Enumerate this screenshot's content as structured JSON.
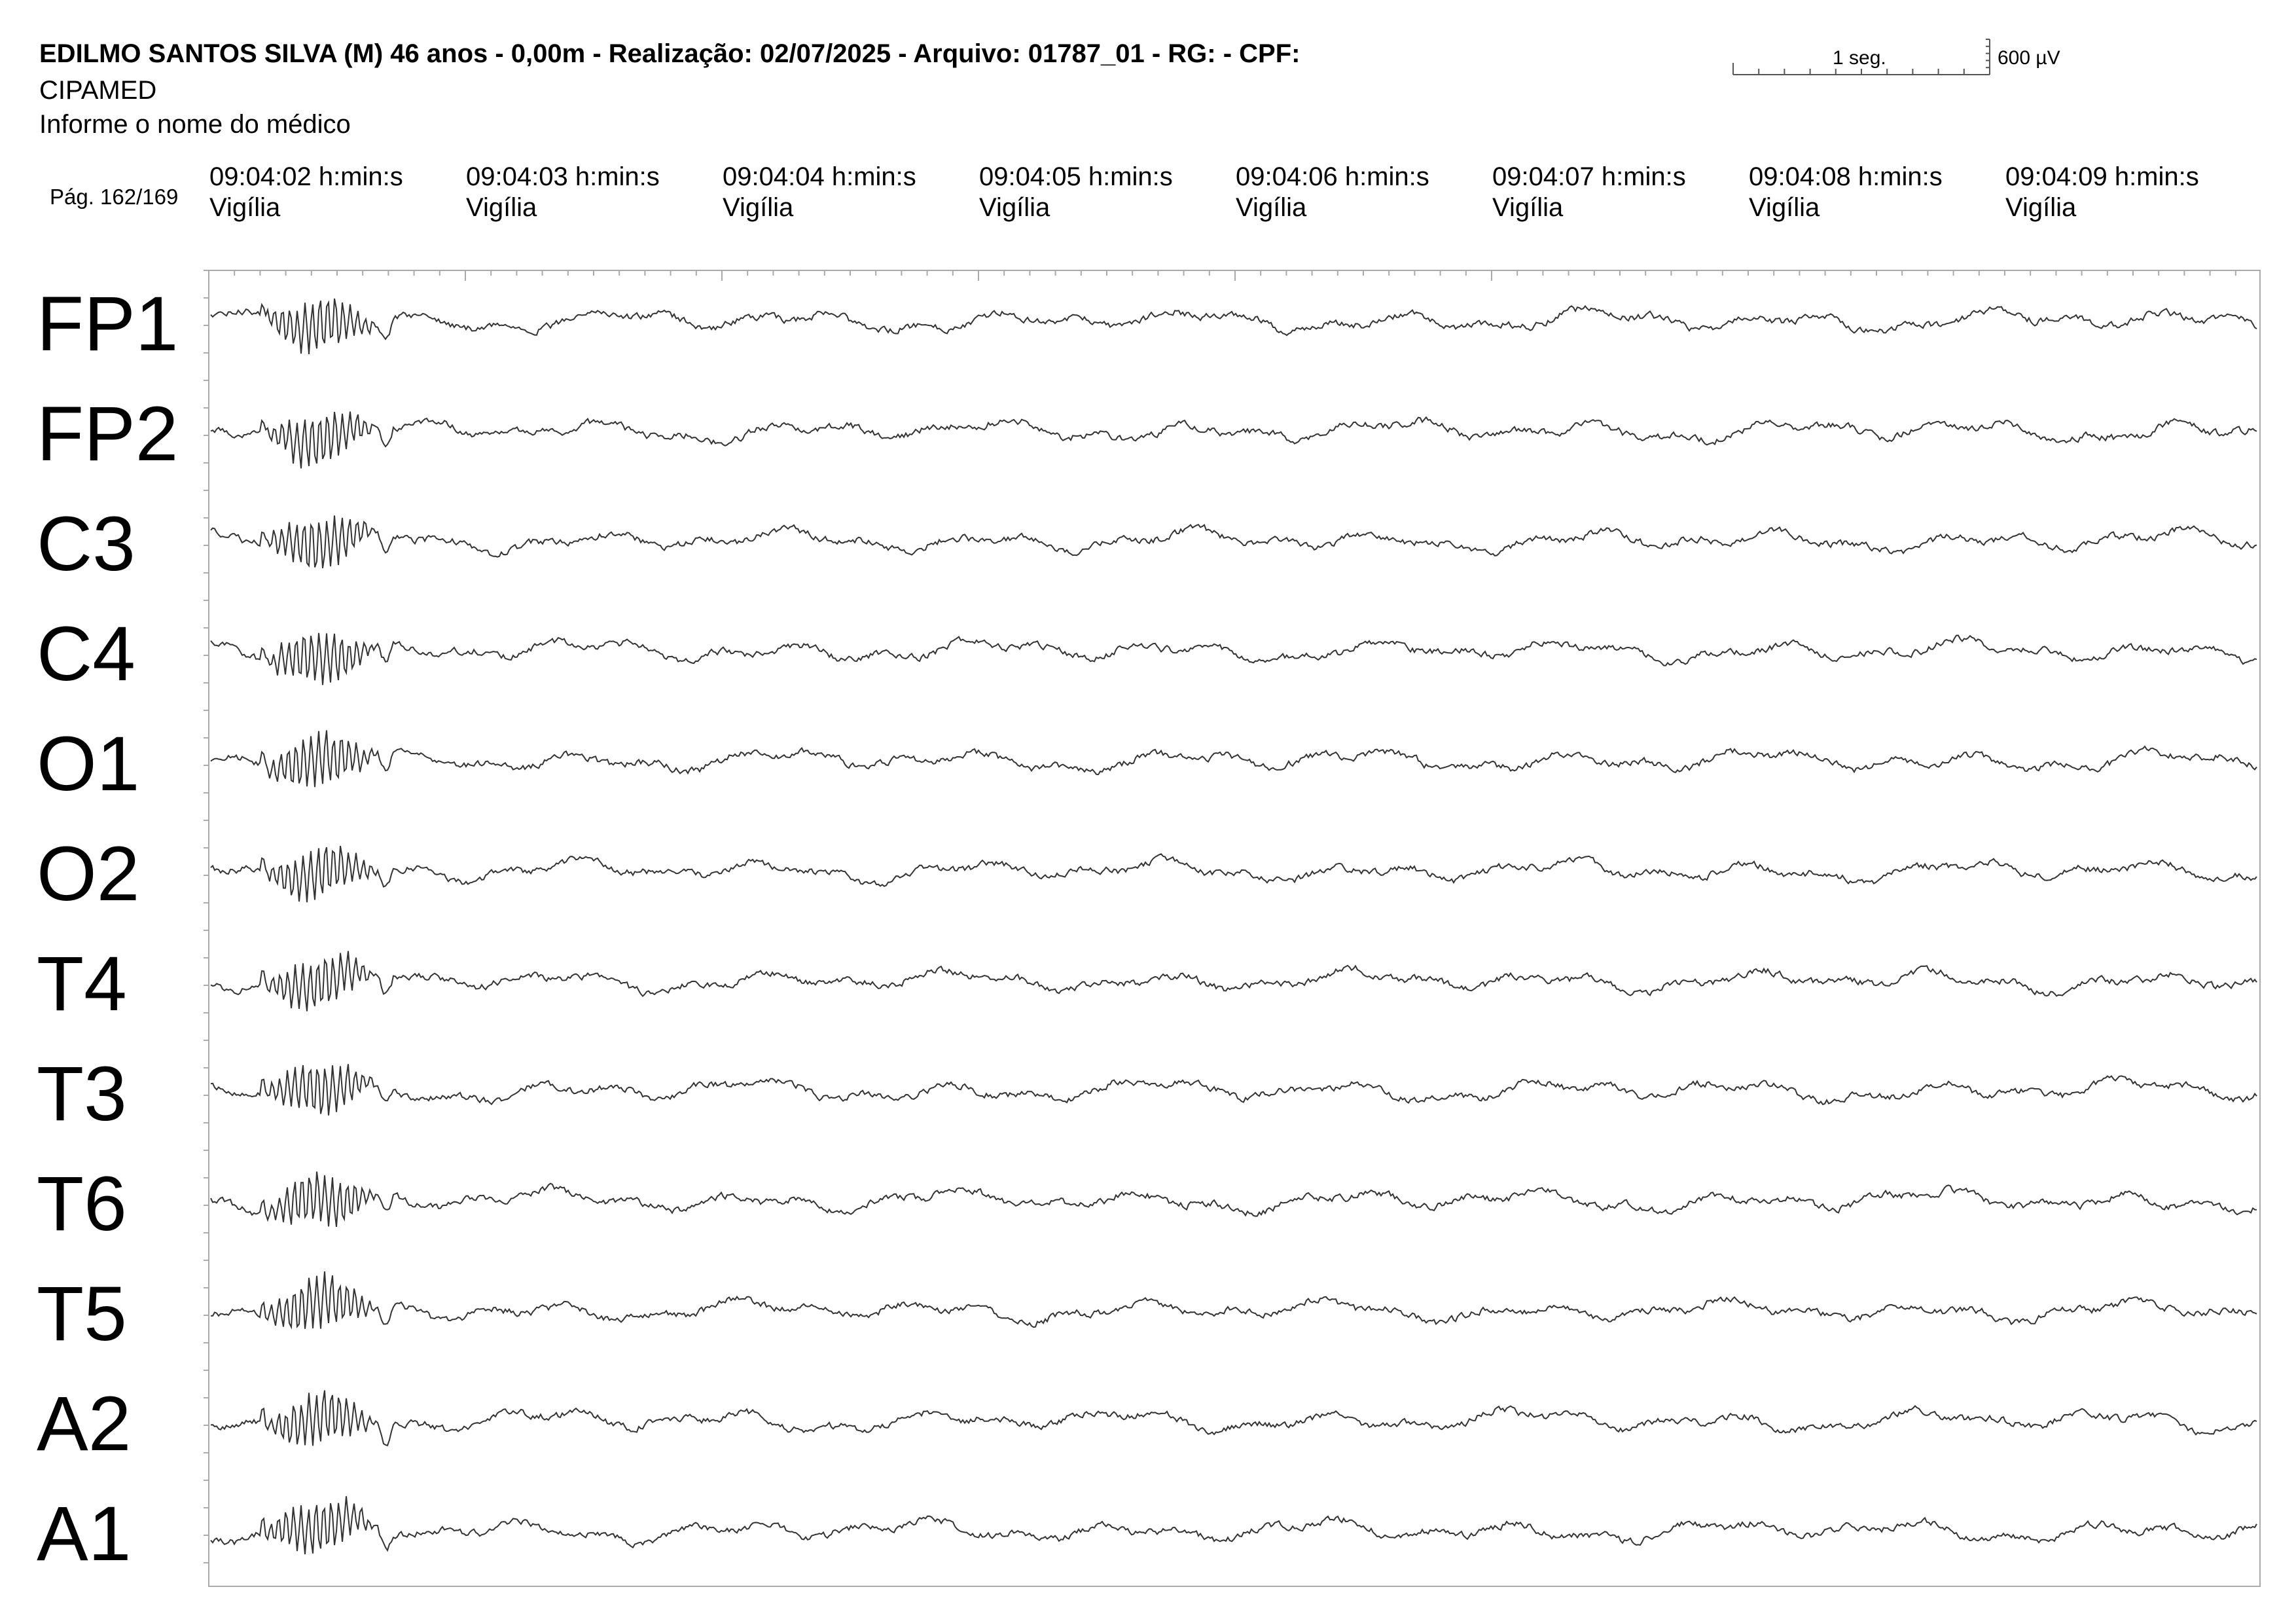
{
  "header": {
    "title": "EDILMO SANTOS SILVA (M) 46 anos - 0,00m - Realização: 02/07/2025 - Arquivo: 01787_01 - RG:  - CPF:",
    "clinic": "CIPAMED",
    "physician": "Informe o nome do médico",
    "page": "Pág. 162/169"
  },
  "scale": {
    "time_label": "1 seg.",
    "amplitude_label": "600 µV"
  },
  "time_columns": [
    {
      "time": "09:04:02 h:min:s",
      "state": "Vigília"
    },
    {
      "time": "09:04:03 h:min:s",
      "state": "Vigília"
    },
    {
      "time": "09:04:04 h:min:s",
      "state": "Vigília"
    },
    {
      "time": "09:04:05 h:min:s",
      "state": "Vigília"
    },
    {
      "time": "09:04:06 h:min:s",
      "state": "Vigília"
    },
    {
      "time": "09:04:07 h:min:s",
      "state": "Vigília"
    },
    {
      "time": "09:04:08 h:min:s",
      "state": "Vigília"
    },
    {
      "time": "09:04:09 h:min:s",
      "state": "Vigília"
    }
  ],
  "channels": [
    "FP1",
    "FP2",
    "C3",
    "C4",
    "O1",
    "O2",
    "T4",
    "T3",
    "T6",
    "T5",
    "A2",
    "A1"
  ],
  "colors": {
    "trace": "#333333",
    "frame": "#aaaaaa",
    "text": "#000000"
  }
}
